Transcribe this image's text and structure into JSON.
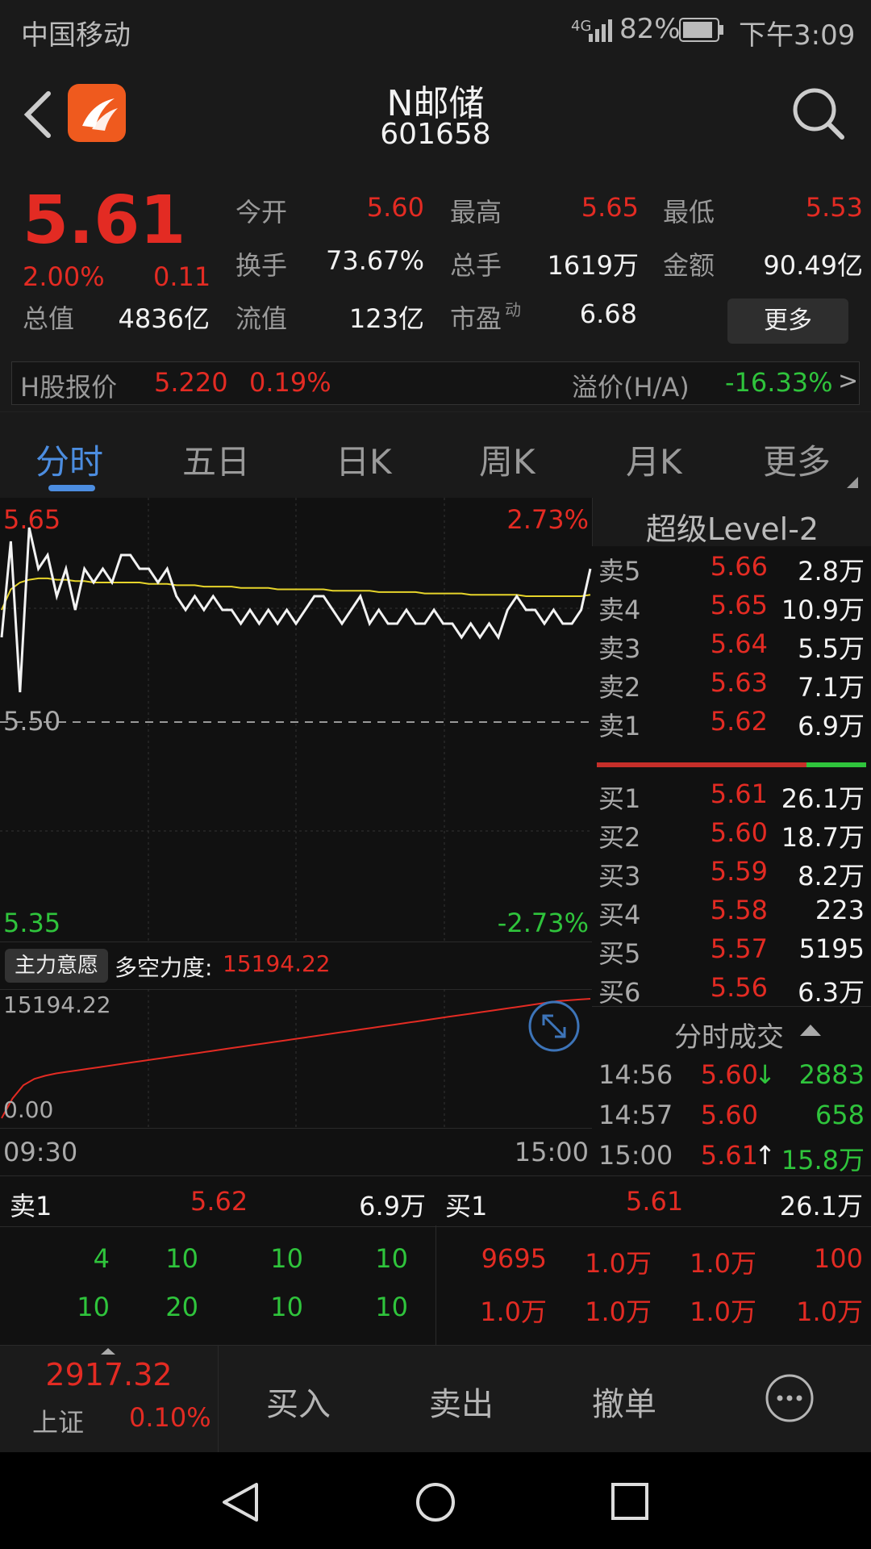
{
  "status": {
    "carrier": "中国移动",
    "network": "4G",
    "battery": "82%",
    "time": "下午3:09"
  },
  "header": {
    "name": "N邮储",
    "code": "601658"
  },
  "quote": {
    "price": "5.61",
    "change_pct": "2.00%",
    "change": "0.11",
    "stats": [
      {
        "label": "今开",
        "value": "5.60",
        "color": "red"
      },
      {
        "label": "最高",
        "value": "5.65",
        "color": "red"
      },
      {
        "label": "最低",
        "value": "5.53",
        "color": "red"
      },
      {
        "label": "换手",
        "value": "73.67%",
        "color": "white"
      },
      {
        "label": "总手",
        "value": "1619万",
        "color": "white"
      },
      {
        "label": "金额",
        "value": "90.49亿",
        "color": "white"
      },
      {
        "label": "总值",
        "value": "4836亿",
        "color": "white"
      },
      {
        "label": "流值",
        "value": "123亿",
        "color": "white"
      },
      {
        "label": "市盈",
        "value": "6.68",
        "color": "white"
      }
    ],
    "pe_superscript": "动",
    "more_button": "更多"
  },
  "hshare": {
    "label": "H股报价",
    "price": "5.220",
    "pct": "0.19%",
    "premium_label": "溢价(H/A)",
    "premium_value": "-16.33%",
    "arrow": ">"
  },
  "tabs": [
    "分时",
    "五日",
    "日K",
    "周K",
    "月K",
    "更多"
  ],
  "chart": {
    "y_high": "5.65",
    "y_mid": "5.50",
    "y_low": "5.35",
    "pct_high": "2.73%",
    "pct_low": "-2.73%",
    "indicator_button": "主力意愿",
    "indicator_label": "多空力度:",
    "indicator_value": "15194.22",
    "sub_high": "15194.22",
    "sub_low": "0.00",
    "time_start": "09:30",
    "time_end": "15:00"
  },
  "chart_data": {
    "type": "line",
    "ylim": [
      5.35,
      5.65
    ],
    "series": [
      {
        "name": "price",
        "values": [
          5.56,
          5.63,
          5.52,
          5.64,
          5.61,
          5.62,
          5.59,
          5.61,
          5.58,
          5.61,
          5.6,
          5.61,
          5.6,
          5.62,
          5.62,
          5.61,
          5.61,
          5.6,
          5.61,
          5.59,
          5.58,
          5.59,
          5.58,
          5.59,
          5.58,
          5.58,
          5.57,
          5.58,
          5.57,
          5.58,
          5.57,
          5.58,
          5.57,
          5.58,
          5.59,
          5.59,
          5.58,
          5.57,
          5.58,
          5.59,
          5.57,
          5.58,
          5.57,
          5.57,
          5.58,
          5.57,
          5.57,
          5.58,
          5.57,
          5.57,
          5.56,
          5.57,
          5.56,
          5.57,
          5.56,
          5.58,
          5.59,
          5.58,
          5.58,
          5.57,
          5.58,
          5.57,
          5.57,
          5.58,
          5.61
        ]
      },
      {
        "name": "avg",
        "values": [
          5.58,
          5.595,
          5.6,
          5.602,
          5.603,
          5.603,
          5.602,
          5.602,
          5.601,
          5.601,
          5.6,
          5.6,
          5.6,
          5.6,
          5.6,
          5.6,
          5.599,
          5.599,
          5.599,
          5.598,
          5.598,
          5.598,
          5.597,
          5.597,
          5.597,
          5.597,
          5.596,
          5.596,
          5.596,
          5.596,
          5.595,
          5.595,
          5.595,
          5.595,
          5.595,
          5.595,
          5.594,
          5.594,
          5.594,
          5.594,
          5.594,
          5.593,
          5.593,
          5.593,
          5.593,
          5.593,
          5.592,
          5.592,
          5.592,
          5.592,
          5.592,
          5.591,
          5.591,
          5.591,
          5.591,
          5.591,
          5.591,
          5.59,
          5.59,
          5.59,
          5.59,
          5.59,
          5.59,
          5.59,
          5.591
        ]
      }
    ],
    "sub_series": {
      "name": "多空力度",
      "ylim": [
        0,
        15194.22
      ],
      "values": [
        0,
        2500,
        4200,
        5000,
        5400,
        5700,
        5900,
        6100,
        6300,
        6500,
        6700,
        6900,
        7100,
        7300,
        7500,
        7700,
        7900,
        8100,
        8300,
        8500,
        8700,
        8900,
        9100,
        9300,
        9500,
        9700,
        9900,
        10100,
        10300,
        10500,
        10700,
        10900,
        11100,
        11300,
        11500,
        11700,
        11900,
        12100,
        12300,
        12500,
        12700,
        12900,
        13100,
        13300,
        13500,
        13700,
        13900,
        14100,
        14300,
        14500,
        14700,
        14900,
        15000,
        15100,
        15194.22
      ]
    }
  },
  "level2": {
    "title": "超级Level-2",
    "asks": [
      {
        "label": "卖5",
        "price": "5.66",
        "volume": "2.8万"
      },
      {
        "label": "卖4",
        "price": "5.65",
        "volume": "10.9万"
      },
      {
        "label": "卖3",
        "price": "5.64",
        "volume": "5.5万"
      },
      {
        "label": "卖2",
        "price": "5.63",
        "volume": "7.1万"
      },
      {
        "label": "卖1",
        "price": "5.62",
        "volume": "6.9万"
      }
    ],
    "bids": [
      {
        "label": "买1",
        "price": "5.61",
        "volume": "26.1万"
      },
      {
        "label": "买2",
        "price": "5.60",
        "volume": "18.7万"
      },
      {
        "label": "买3",
        "price": "5.59",
        "volume": "8.2万"
      },
      {
        "label": "买4",
        "price": "5.58",
        "volume": "223"
      },
      {
        "label": "买5",
        "price": "5.57",
        "volume": "5195"
      },
      {
        "label": "买6",
        "price": "5.56",
        "volume": "6.3万"
      }
    ],
    "ticks_title": "分时成交",
    "ticks": [
      {
        "time": "14:56",
        "price": "5.60",
        "dir": "↓",
        "volume": "2883"
      },
      {
        "time": "14:57",
        "price": "5.60",
        "dir": "",
        "volume": "658"
      },
      {
        "time": "15:00",
        "price": "5.61",
        "dir": "↑",
        "volume": "15.8万"
      }
    ]
  },
  "queue": {
    "sell_label": "卖1",
    "sell_price": "5.62",
    "sell_vol": "6.9万",
    "buy_label": "买1",
    "buy_price": "5.61",
    "buy_vol": "26.1万",
    "sell_rows": [
      [
        "4",
        "10",
        "10",
        "10"
      ],
      [
        "10",
        "20",
        "10",
        "10"
      ]
    ],
    "buy_rows": [
      [
        "9695",
        "1.0万",
        "1.0万",
        "100"
      ],
      [
        "1.0万",
        "1.0万",
        "1.0万",
        "1.0万"
      ]
    ]
  },
  "index": {
    "value": "2917.32",
    "name": "上证",
    "pct": "0.10%"
  },
  "toolbar": {
    "buy": "买入",
    "sell": "卖出",
    "cancel": "撤单"
  }
}
